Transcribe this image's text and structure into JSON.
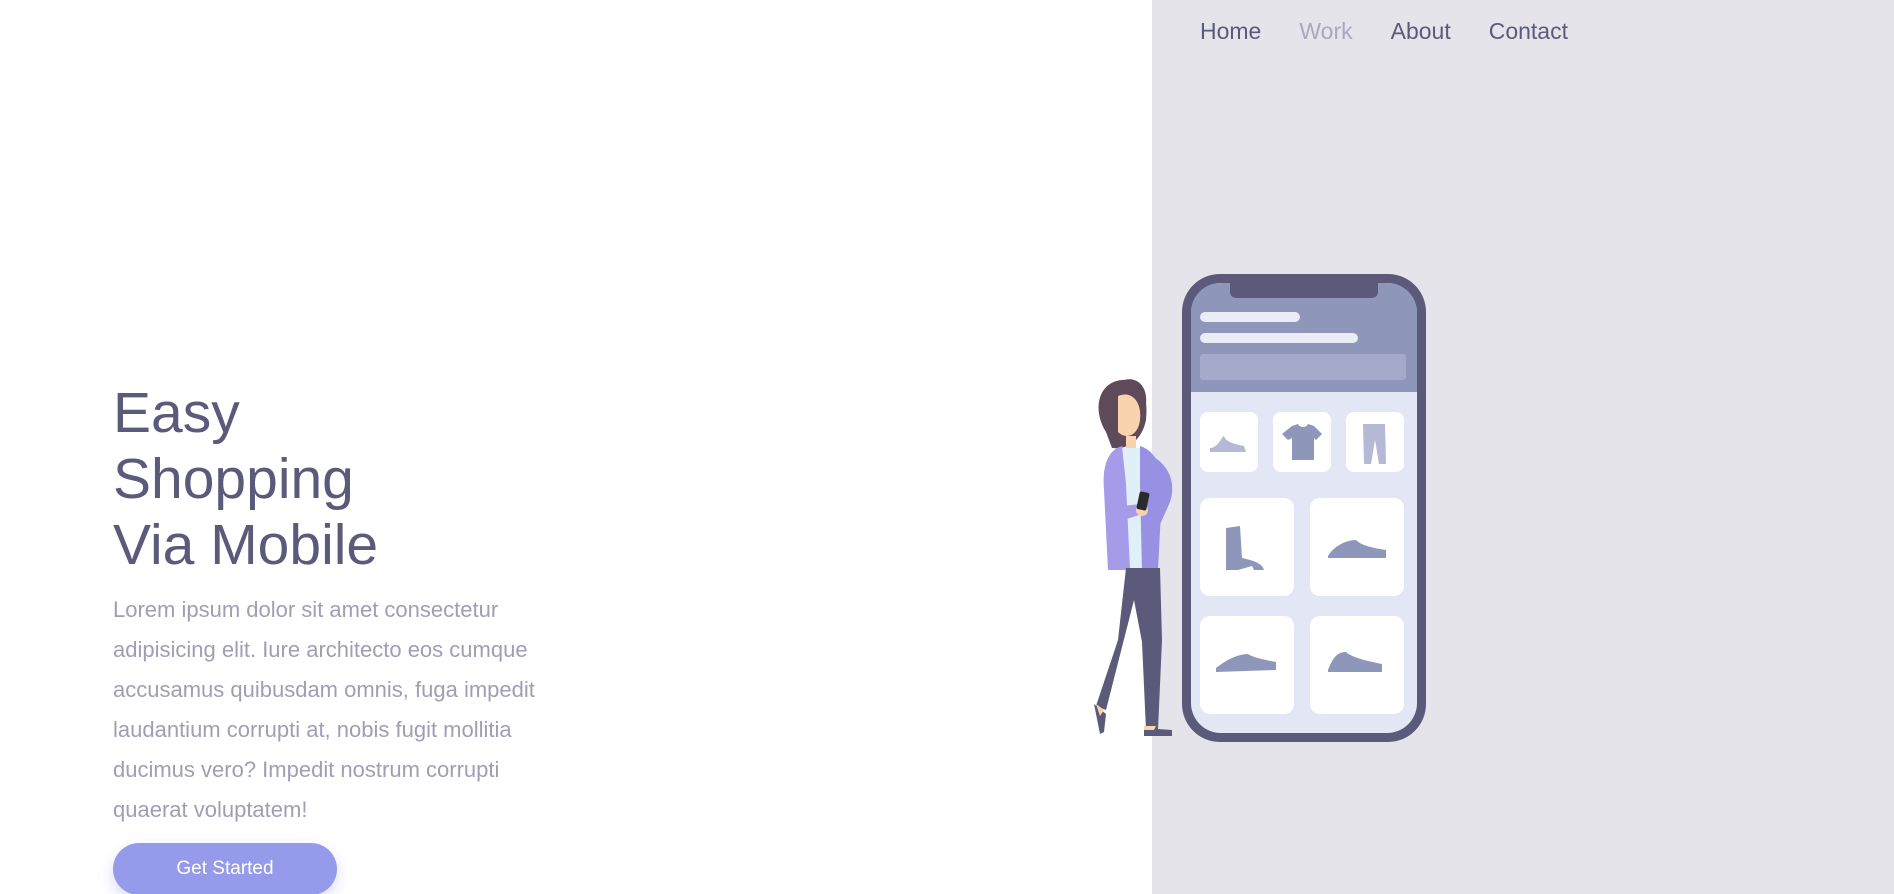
{
  "nav": {
    "items": [
      {
        "label": "Home",
        "active": false
      },
      {
        "label": "Work",
        "active": true
      },
      {
        "label": "About",
        "active": false
      },
      {
        "label": "Contact",
        "active": false
      }
    ]
  },
  "hero": {
    "title_lines": [
      "Easy",
      "Shopping",
      "Via Mobile"
    ],
    "description": "Lorem ipsum dolor sit amet consectetur adipisicing elit. Iure architecto eos cumque accusamus quibusdam omnis, fuga impedit laudantium corrupti at, nobis fugit mollitia ducimus vero? Impedit nostrum corrupti quaerat voluptatem!",
    "cta_label": "Get Started"
  },
  "illustration": {
    "icons": [
      "shoe-icon",
      "tshirt-icon",
      "pants-icon",
      "boot-icon",
      "sneaker-icon",
      "loafer-icon",
      "sneaker-icon"
    ]
  },
  "colors": {
    "accent": "#959aea",
    "heading": "#5b5a7a",
    "body_text": "#a09eb4",
    "right_panel": "#e5e4ea",
    "phone_frame": "#5b5a7a",
    "phone_header": "#8e97b9"
  }
}
